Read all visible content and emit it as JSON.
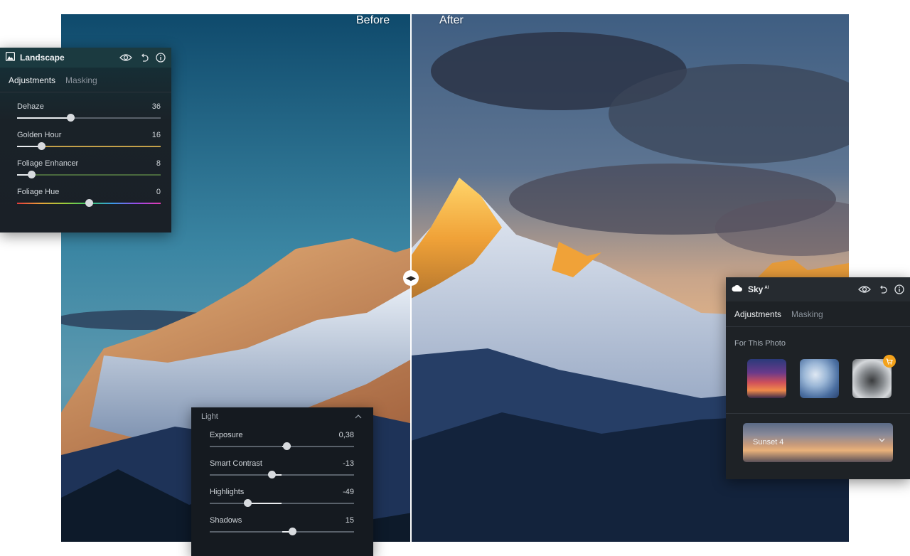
{
  "compare": {
    "before_label": "Before",
    "after_label": "After",
    "handle_icon": "double-arrow-icon"
  },
  "landscape_panel": {
    "title": "Landscape",
    "icons": [
      "landscape-icon",
      "eye-icon",
      "undo-icon",
      "info-icon"
    ],
    "tabs": [
      {
        "label": "Adjustments",
        "active": true
      },
      {
        "label": "Masking",
        "active": false
      }
    ],
    "sliders": [
      {
        "label": "Dehaze",
        "value": "36",
        "position": 0.37
      },
      {
        "label": "Golden Hour",
        "value": "16",
        "position": 0.17
      },
      {
        "label": "Foliage Enhancer",
        "value": "8",
        "position": 0.1
      },
      {
        "label": "Foliage Hue",
        "value": "0",
        "position": 0.5
      }
    ]
  },
  "light_panel": {
    "section_title": "Light",
    "icons": [
      "chevron-up-icon"
    ],
    "sliders": [
      {
        "label": "Exposure",
        "value": "0,38",
        "position": 0.53
      },
      {
        "label": "Smart Contrast",
        "value": "-13",
        "position": 0.43
      },
      {
        "label": "Highlights",
        "value": "-49",
        "position": 0.26
      },
      {
        "label": "Shadows",
        "value": "15",
        "position": 0.57
      }
    ]
  },
  "sky_panel": {
    "title": "Sky",
    "title_sup": "AI",
    "icons": [
      "cloud-icon",
      "eye-icon",
      "undo-icon",
      "info-icon",
      "cart-icon",
      "chevron-down-icon"
    ],
    "tabs": [
      {
        "label": "Adjustments",
        "active": true
      },
      {
        "label": "Masking",
        "active": false
      }
    ],
    "section_title": "For This Photo",
    "thumbnails": [
      "sunset-sky",
      "blue-cloudy-sky",
      "stormy-sky"
    ],
    "preset_label": "Sunset 4"
  },
  "colors": {
    "accent_badge": "#f3a21b",
    "panel_bg": "#1c2126"
  }
}
